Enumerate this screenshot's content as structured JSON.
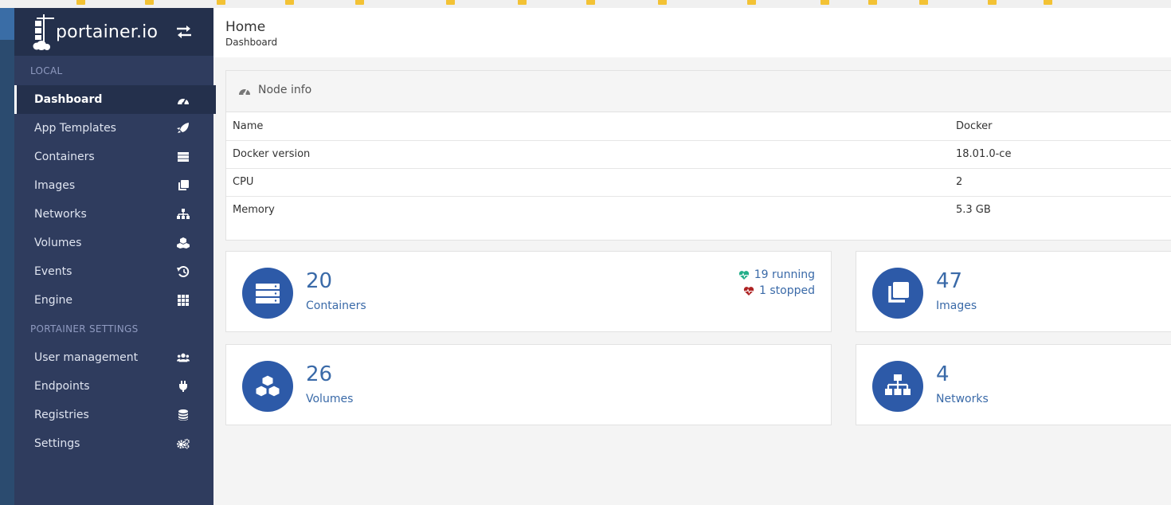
{
  "brand": {
    "logo_text": "portainer.io"
  },
  "sidebar": {
    "section_local": "LOCAL",
    "section_settings": "PORTAINER SETTINGS",
    "items": [
      {
        "label": "Dashboard",
        "icon": "dashboard-icon"
      },
      {
        "label": "App Templates",
        "icon": "rocket-icon"
      },
      {
        "label": "Containers",
        "icon": "server-icon"
      },
      {
        "label": "Images",
        "icon": "clone-icon"
      },
      {
        "label": "Networks",
        "icon": "sitemap-icon"
      },
      {
        "label": "Volumes",
        "icon": "cubes-icon"
      },
      {
        "label": "Events",
        "icon": "history-icon"
      },
      {
        "label": "Engine",
        "icon": "grid-icon"
      },
      {
        "label": "User management",
        "icon": "users-icon"
      },
      {
        "label": "Endpoints",
        "icon": "plug-icon"
      },
      {
        "label": "Registries",
        "icon": "database-icon"
      },
      {
        "label": "Settings",
        "icon": "cogs-icon"
      }
    ]
  },
  "header": {
    "title": "Home",
    "breadcrumb": "Dashboard"
  },
  "node_info": {
    "title": "Node info",
    "rows": [
      {
        "key": "Name",
        "value": "Docker"
      },
      {
        "key": "Docker version",
        "value": "18.01.0-ce"
      },
      {
        "key": "CPU",
        "value": "2"
      },
      {
        "key": "Memory",
        "value": "5.3 GB"
      }
    ]
  },
  "widgets": {
    "containers": {
      "count": "20",
      "label": "Containers",
      "running": "19 running",
      "stopped": "1 stopped"
    },
    "images": {
      "count": "47",
      "label": "Images"
    },
    "volumes": {
      "count": "26",
      "label": "Volumes"
    },
    "networks": {
      "count": "4",
      "label": "Networks"
    }
  },
  "colors": {
    "sidebar": "#2f3c5e",
    "accent": "#2d5aa8",
    "running": "#23ae89",
    "stopped": "#ae2323"
  }
}
